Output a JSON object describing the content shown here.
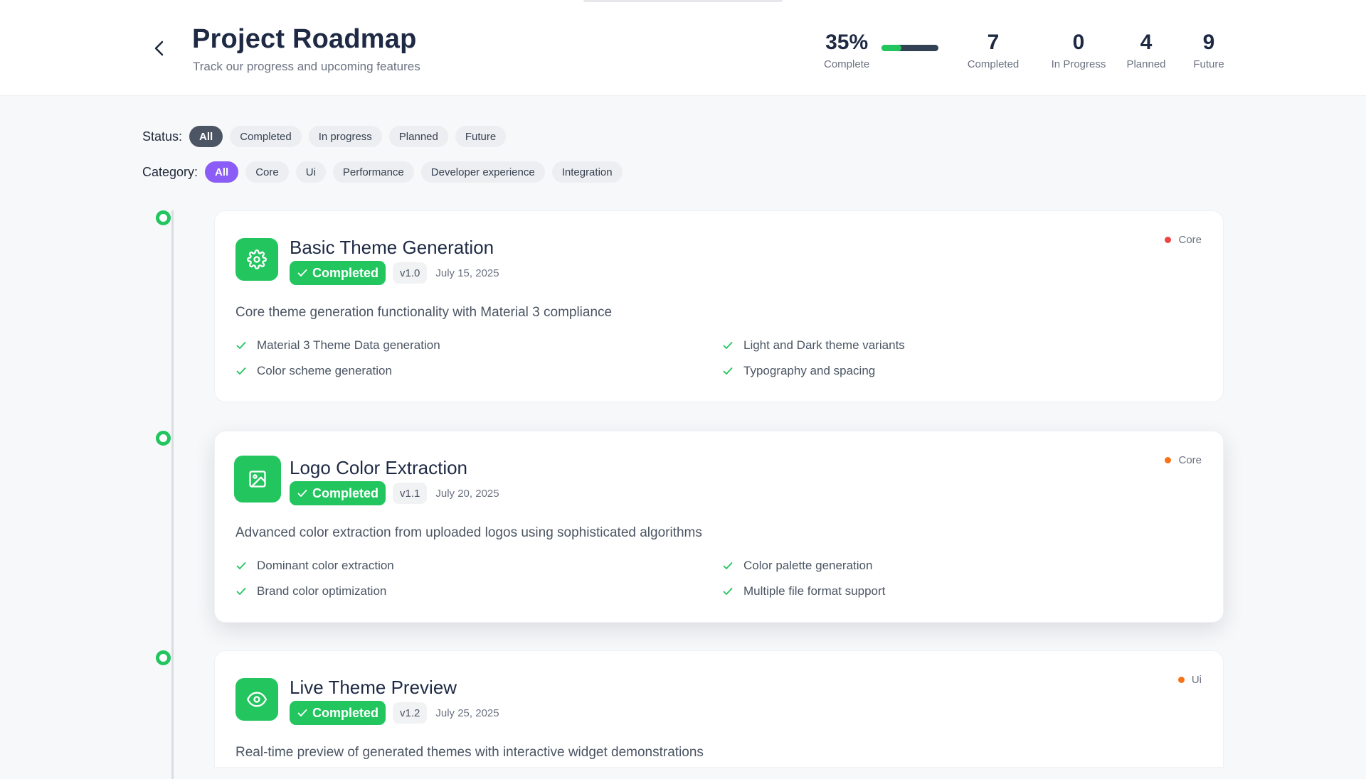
{
  "header": {
    "title": "Project Roadmap",
    "subtitle": "Track our progress and upcoming features",
    "progress": {
      "value": "35%",
      "label": "Complete",
      "fraction": 0.35
    },
    "stats": [
      {
        "value": "7",
        "label": "Completed"
      },
      {
        "value": "0",
        "label": "In Progress"
      },
      {
        "value": "4",
        "label": "Planned"
      },
      {
        "value": "9",
        "label": "Future"
      }
    ]
  },
  "filters": {
    "status_label": "Status:",
    "status_chips": [
      "All",
      "Completed",
      "In progress",
      "Planned",
      "Future"
    ],
    "status_selected": "All",
    "category_label": "Category:",
    "category_chips": [
      "All",
      "Core",
      "Ui",
      "Performance",
      "Developer experience",
      "Integration"
    ],
    "category_selected": "All"
  },
  "colors": {
    "completed_green": "#22c55e",
    "status_active": "#4b5563",
    "category_active": "#8b5cf6",
    "core_red": "#ef4444",
    "orange": "#f97316"
  },
  "items": [
    {
      "icon": "gear-icon",
      "title": "Basic Theme Generation",
      "status": "Completed",
      "version": "v1.0",
      "date": "July 15, 2025",
      "category": "Core",
      "category_color": "#ef4444",
      "description": "Core theme generation functionality with Material 3 compliance",
      "features": [
        "Material 3 Theme Data generation",
        "Light and Dark theme variants",
        "Color scheme generation",
        "Typography and spacing"
      ]
    },
    {
      "icon": "image-icon",
      "title": "Logo Color Extraction",
      "status": "Completed",
      "version": "v1.1",
      "date": "July 20, 2025",
      "category": "Core",
      "category_color": "#f97316",
      "description": "Advanced color extraction from uploaded logos using sophisticated algorithms",
      "features": [
        "Dominant color extraction",
        "Color palette generation",
        "Brand color optimization",
        "Multiple file format support"
      ]
    },
    {
      "icon": "eye-icon",
      "title": "Live Theme Preview",
      "status": "Completed",
      "version": "v1.2",
      "date": "July 25, 2025",
      "category": "Ui",
      "category_color": "#f97316",
      "description": "Real-time preview of generated themes with interactive widget demonstrations",
      "features": []
    }
  ]
}
